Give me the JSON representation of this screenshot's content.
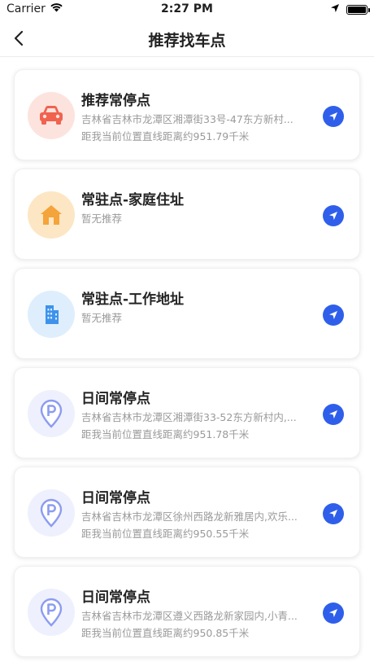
{
  "status_bar": {
    "carrier": "Carrier",
    "time": "2:27 PM"
  },
  "header": {
    "title": "推荐找车点"
  },
  "cards": [
    {
      "title": "推荐常停点",
      "address": "吉林省吉林市龙潭区湘潭街33号-47东方新村...",
      "distance": "距我当前位置直线距离约951.79千米",
      "icon": "car-icon"
    },
    {
      "title": "常驻点-家庭住址",
      "status": "暂无推荐",
      "icon": "home-icon"
    },
    {
      "title": "常驻点-工作地址",
      "status": "暂无推荐",
      "icon": "building-icon"
    },
    {
      "title": "日间常停点",
      "address": "吉林省吉林市龙潭区湘潭街33-52东方新村内,...",
      "distance": "距我当前位置直线距离约951.78千米",
      "icon": "parking-pin-icon"
    },
    {
      "title": "日间常停点",
      "address": "吉林省吉林市龙潭区徐州西路龙新雅居内,欢乐...",
      "distance": "距我当前位置直线距离约950.55千米",
      "icon": "parking-pin-icon"
    },
    {
      "title": "日间常停点",
      "address": "吉林省吉林市龙潭区遵义西路龙新家园内,小青...",
      "distance": "距我当前位置直线距离约950.85千米",
      "icon": "parking-pin-icon"
    }
  ],
  "colors": {
    "accent": "#2f5fea",
    "car_bg": "#fde3de",
    "car_fg": "#f0634f",
    "home_bg": "#fde6c4",
    "home_fg": "#f4a43a",
    "building_bg": "#deeefc",
    "building_fg": "#3d93ec",
    "parking_bg": "#eef0fd",
    "parking_fg": "#8c9cf0"
  }
}
